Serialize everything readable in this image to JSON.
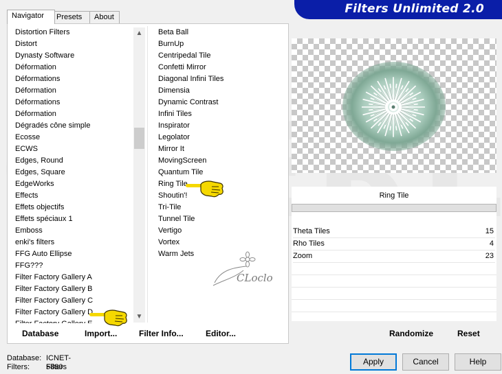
{
  "app": {
    "title": "Filters Unlimited 2.0"
  },
  "tabs": [
    {
      "label": "Navigator"
    },
    {
      "label": "Presets"
    },
    {
      "label": "About"
    }
  ],
  "categories": [
    "Distortion Filters",
    "Distort",
    "Dynasty Software",
    "Déformation",
    "Déformations",
    "Déformation",
    "Déformations",
    "Déformation",
    "Dégradés cône simple",
    "Ecosse",
    "ECWS",
    "Edges, Round",
    "Edges, Square",
    "EdgeWorks",
    "Effects",
    "Effets objectifs",
    "Effets spéciaux 1",
    "Emboss",
    "enki's filters",
    "FFG Auto Ellipse",
    "FFG???",
    "Filter Factory Gallery A",
    "Filter Factory Gallery B",
    "Filter Factory Gallery C",
    "Filter Factory Gallery D",
    "Filter Factory Gallery E"
  ],
  "filters": [
    "Beta Ball",
    "BurnUp",
    "Centripedal Tile",
    "Confetti Mirror",
    "Diagonal Infini Tiles",
    "Dimensia",
    "Dynamic Contrast",
    "Infini Tiles",
    "Inspirator",
    "Legolator",
    "Mirror It",
    "MovingScreen",
    "Quantum Tile",
    "Ring Tile",
    "Shoutin'!",
    "Tri-Tile",
    "Tunnel Tile",
    "Vertigo",
    "Vortex",
    "Warm Jets"
  ],
  "watermark": {
    "text": "CLoclo"
  },
  "bottom_buttons": {
    "database": "Database",
    "import": "Import...",
    "filter_info": "Filter Info...",
    "editor": "Editor..."
  },
  "selected_filter": "Ring Tile",
  "params": [
    {
      "name": "Theta Tiles",
      "value": "15"
    },
    {
      "name": "Rho Tiles",
      "value": "4"
    },
    {
      "name": "Zoom",
      "value": "23"
    }
  ],
  "right_buttons": {
    "randomize": "Randomize",
    "reset": "Reset"
  },
  "status": {
    "database_label": "Database:",
    "database_value": "ICNET-Filters",
    "filters_label": "Filters:",
    "filters_value": "5860"
  },
  "dialog_buttons": {
    "apply": "Apply",
    "cancel": "Cancel",
    "help": "Help"
  },
  "colors": {
    "banner": "#0a1ea8",
    "pointer": "#f5d800"
  }
}
